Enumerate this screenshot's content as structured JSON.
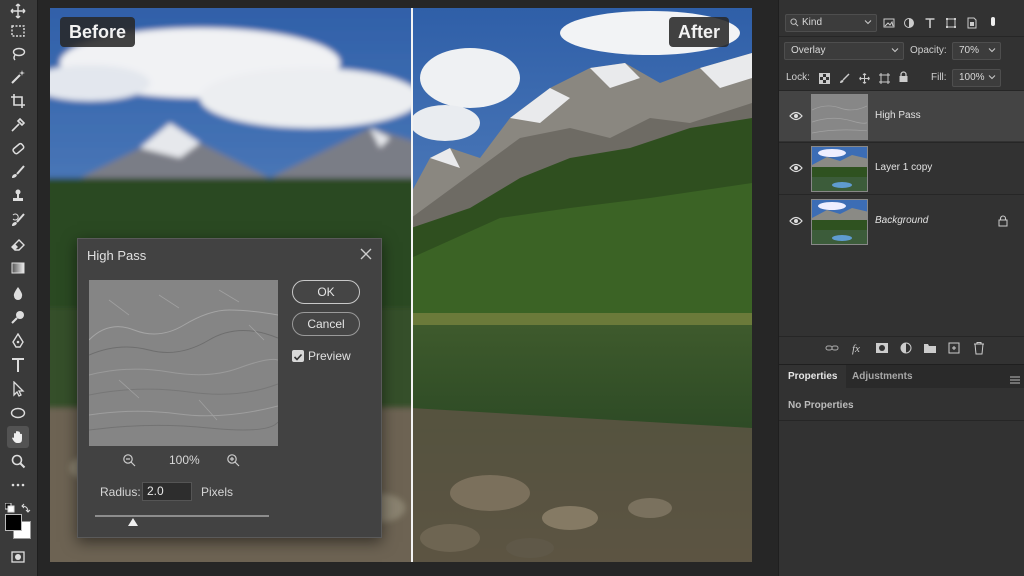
{
  "canvas": {
    "before_label": "Before",
    "after_label": "After"
  },
  "dialog": {
    "title": "High Pass",
    "ok_label": "OK",
    "cancel_label": "Cancel",
    "preview_label": "Preview",
    "preview_checked": true,
    "zoom_value": "100%",
    "radius_label": "Radius:",
    "radius_value": "2.0",
    "radius_unit": "Pixels",
    "radius_slider_fraction": 0.22
  },
  "layers_panel": {
    "filter_kind": "Kind",
    "blend_mode": "Overlay",
    "opacity_label": "Opacity:",
    "opacity_value": "70%",
    "lock_label": "Lock:",
    "fill_label": "Fill:",
    "fill_value": "100%",
    "layers": [
      {
        "name": "High Pass",
        "selected": true,
        "visible": true,
        "locked": false
      },
      {
        "name": "Layer 1 copy",
        "selected": false,
        "visible": true,
        "locked": false
      },
      {
        "name": "Background",
        "selected": false,
        "visible": true,
        "locked": true
      }
    ]
  },
  "properties_panel": {
    "tabs": [
      "Properties",
      "Adjustments"
    ],
    "active_tab": "Properties",
    "empty_text": "No Properties"
  },
  "colors": {
    "foreground": "#000000",
    "background": "#ffffff",
    "ui_dark": "#262626",
    "panel": "#323232",
    "accent_line": "#f4f4f4"
  }
}
